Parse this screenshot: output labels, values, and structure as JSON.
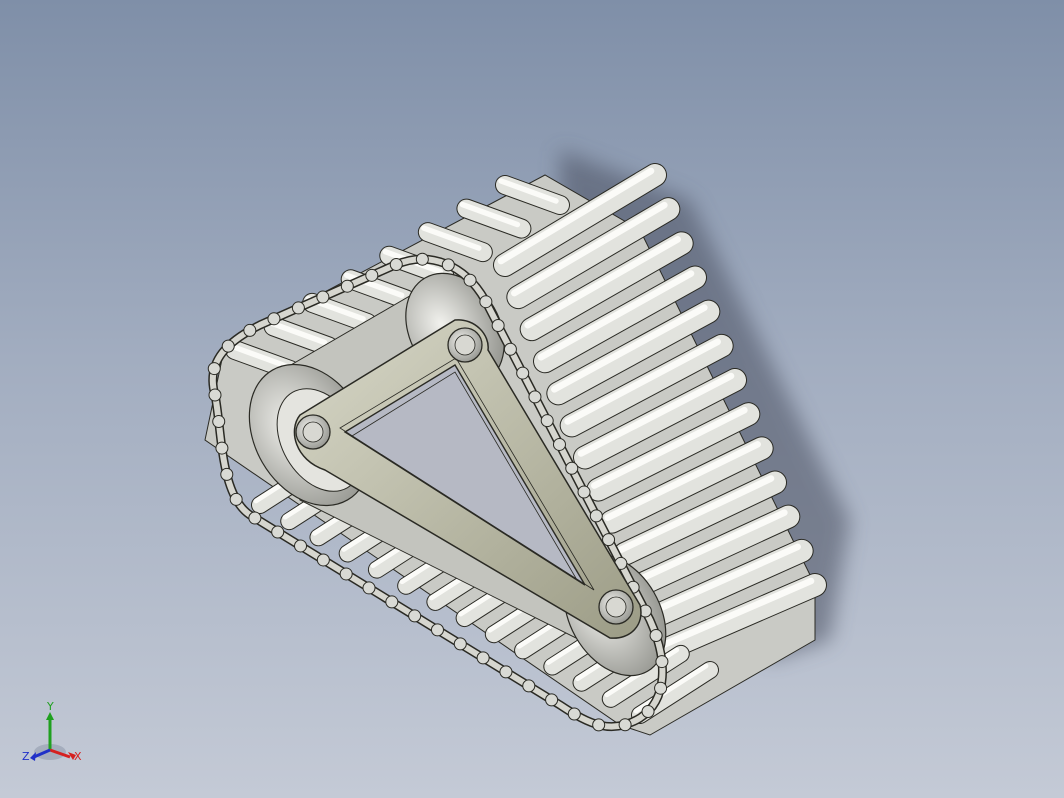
{
  "viewport": {
    "background_top": "#7f8fa8",
    "background_bottom": "#c4cad6"
  },
  "model": {
    "subject": "tracked-track-assembly",
    "track_color": "#d9dad5",
    "frame_color": "#b9b9a4",
    "edge_color": "#2a2a24"
  },
  "triad": {
    "x_label": "X",
    "y_label": "Y",
    "z_label": "Z",
    "x_color": "#d62020",
    "y_color": "#1fa01f",
    "z_color": "#2030c8"
  }
}
